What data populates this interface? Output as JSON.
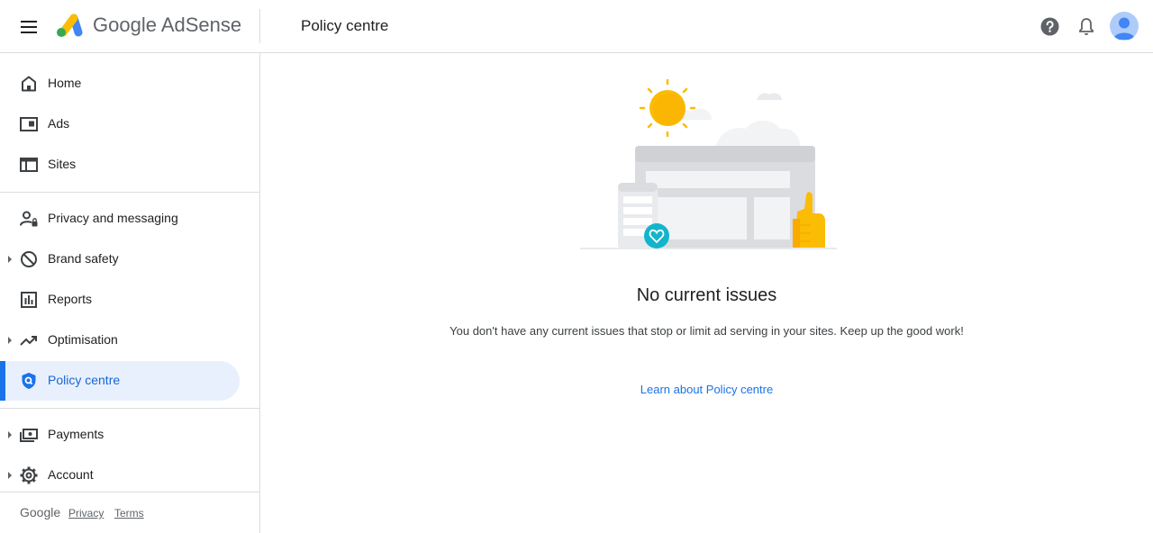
{
  "header": {
    "brand": "Google AdSense",
    "title": "Policy centre",
    "colors": {
      "logo_yellow": "#fbbc04",
      "logo_green": "#34a853",
      "logo_blue": "#4285f4"
    }
  },
  "sidebar": {
    "items": [
      {
        "label": "Home",
        "icon": "home-icon",
        "caret": false
      },
      {
        "label": "Ads",
        "icon": "ads-icon",
        "caret": false
      },
      {
        "label": "Sites",
        "icon": "sites-icon",
        "caret": false
      },
      {
        "label": "Privacy and messaging",
        "icon": "privacy-icon",
        "caret": false
      },
      {
        "label": "Brand safety",
        "icon": "block-icon",
        "caret": true
      },
      {
        "label": "Reports",
        "icon": "reports-icon",
        "caret": false
      },
      {
        "label": "Optimisation",
        "icon": "trending-up-icon",
        "caret": true
      },
      {
        "label": "Policy centre",
        "icon": "shield-icon",
        "caret": false,
        "active": true
      },
      {
        "label": "Payments",
        "icon": "payments-icon",
        "caret": true
      },
      {
        "label": "Account",
        "icon": "gear-icon",
        "caret": true
      }
    ],
    "footer": {
      "google": "Google",
      "privacy": "Privacy",
      "terms": "Terms"
    }
  },
  "main": {
    "title": "No current issues",
    "description": "You don't have any current issues that stop or limit ad serving in your sites. Keep up the good work!",
    "link": "Learn about Policy centre",
    "accent": "#1a73e8"
  }
}
